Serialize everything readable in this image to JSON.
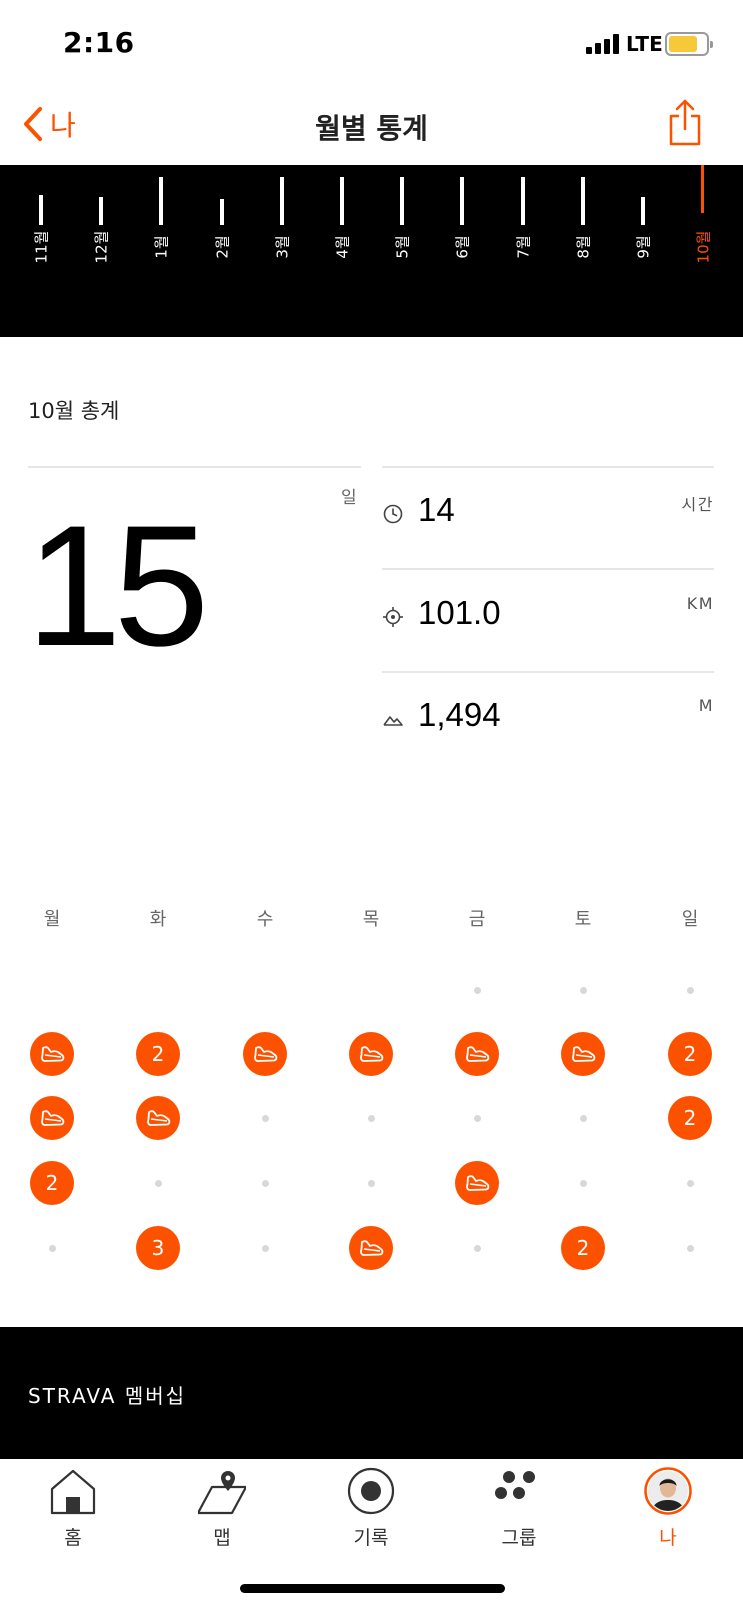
{
  "status_bar": {
    "time": "2:16",
    "network": "LTE"
  },
  "nav": {
    "back_label": "나",
    "title": "월별 통계"
  },
  "months": [
    "11월",
    "12월",
    "1월",
    "2월",
    "3월",
    "4월",
    "5월",
    "6월",
    "7월",
    "8월",
    "9월",
    "10월"
  ],
  "selected_month": "10월",
  "summary": {
    "title": "10월 총계",
    "days_value": "15",
    "days_unit": "일",
    "stats": [
      {
        "icon": "clock-icon",
        "value": "14",
        "unit": "시간"
      },
      {
        "icon": "target-icon",
        "value": "101.0",
        "unit": "KM"
      },
      {
        "icon": "elevation-icon",
        "value": "1,494",
        "unit": "M"
      }
    ]
  },
  "calendar": {
    "weekdays": [
      "월",
      "화",
      "수",
      "목",
      "금",
      "토",
      "일"
    ],
    "weeks": [
      [
        "",
        "",
        "",
        "",
        "dot",
        "dot",
        "dot"
      ],
      [
        "shoe",
        "2",
        "shoe",
        "shoe",
        "shoe",
        "shoe",
        "2"
      ],
      [
        "shoe",
        "shoe",
        "dot",
        "dot",
        "dot",
        "dot",
        "2"
      ],
      [
        "2",
        "dot",
        "dot",
        "dot",
        "shoe",
        "dot",
        "dot"
      ],
      [
        "dot",
        "3",
        "dot",
        "shoe",
        "dot",
        "2",
        "dot"
      ]
    ]
  },
  "membership": {
    "label": "STRAVA 멤버십"
  },
  "tabs": [
    {
      "label": "홈",
      "icon": "home-icon"
    },
    {
      "label": "맵",
      "icon": "map-icon"
    },
    {
      "label": "기록",
      "icon": "record-icon"
    },
    {
      "label": "그룹",
      "icon": "groups-icon"
    },
    {
      "label": "나",
      "icon": "avatar"
    }
  ],
  "colors": {
    "accent": "#fc5200",
    "dark": "#000000",
    "divider": "#e6e6e6"
  }
}
